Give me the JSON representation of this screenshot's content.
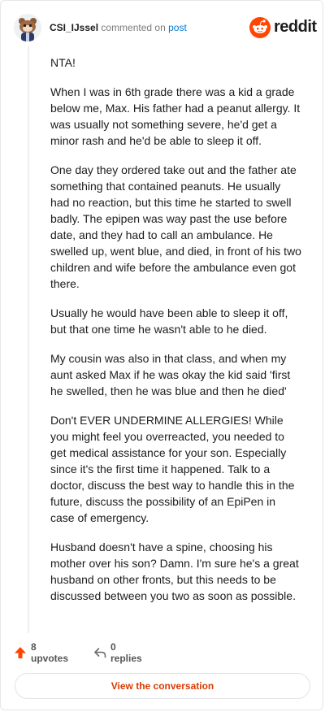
{
  "header": {
    "username": "CSI_IJssel",
    "commented_text": "commented on",
    "post_link": "post",
    "brand": "reddit",
    "brand_color": "#ff4500",
    "avatar_icon": "snoo-avatar-icon"
  },
  "comment": {
    "paragraphs": [
      "NTA!",
      "When I was in 6th grade there was a kid a grade below me, Max. His father had a peanut allergy. It was usually not something severe, he'd get a minor rash and he'd be able to sleep it off.",
      "One day they ordered take out and the father ate something that contained peanuts. He usually had no reaction, but this time he started to swell badly. The epipen was way past the use before date, and they had to call an ambulance. He swelled up, went blue, and died, in front of his two children and wife before the ambulance even got there.",
      "Usually he would have been able to sleep it off, but that one time he wasn't able to he died.",
      "My cousin was also in that class, and when my aunt asked Max if he was okay the kid said 'first he swelled, then he was blue and then he died'",
      "Don't EVER UNDERMINE ALLERGIES! While you might feel you overreacted, you needed to get medical assistance for your son. Especially since it's the first time it happened. Talk to a doctor, discuss the best way to handle this in the future, discuss the possibility of an EpiPen in case of emergency.",
      "Husband doesn't have a spine, choosing his mother over his son? Damn. I'm sure he's a great husband on other fronts, but this needs to be discussed between you two as soon as possible."
    ]
  },
  "actions": {
    "upvotes_label": "8 upvotes",
    "replies_label": "0 replies",
    "upvote_icon": "upvote-arrow-icon",
    "reply_icon": "reply-arrow-icon",
    "upvote_color": "#ff4500"
  },
  "cta": {
    "view_label": "View the conversation",
    "color": "#d93a00"
  }
}
